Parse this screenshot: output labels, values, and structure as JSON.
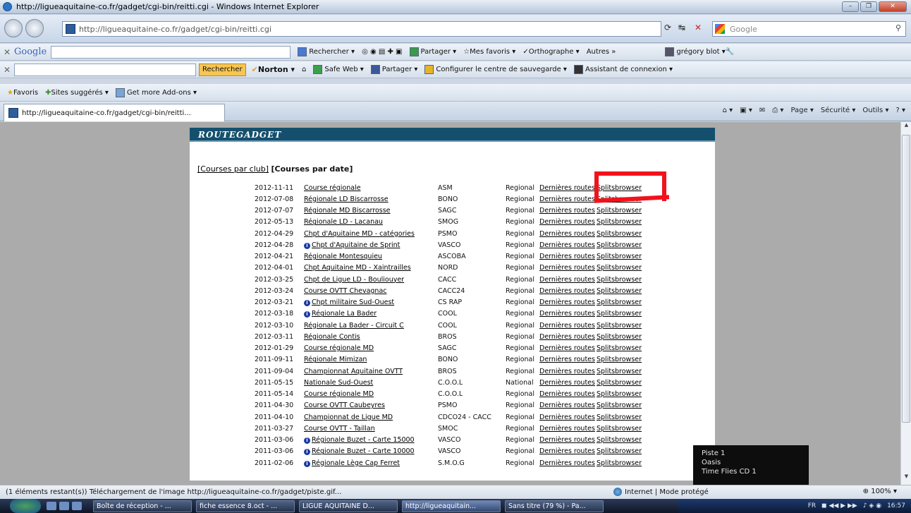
{
  "window": {
    "title": "http://ligueaquitaine-co.fr/gadget/cgi-bin/reitti.cgi - Windows Internet Explorer",
    "buttons": [
      "–",
      "❐",
      "✕"
    ]
  },
  "address": {
    "url": "http://ligueaquitaine-co.fr/gadget/cgi-bin/reitti.cgi",
    "search_placeholder": "Google"
  },
  "google_toolbar": {
    "logo": "Google",
    "items": [
      "Rechercher ▾",
      "Partager ▾",
      "Mes favoris ▾",
      "Orthographe ▾",
      "Autres »",
      "grégory blot ▾"
    ]
  },
  "norton_toolbar": {
    "search_button": "Rechercher",
    "norton": "Norton ▾",
    "items": [
      "Safe Web ▾",
      "Partager ▾",
      "Configurer le centre de sauvegarde ▾",
      "Assistant de connexion ▾"
    ]
  },
  "favorites_bar": {
    "favoris": "Favoris",
    "items": [
      "Sites suggérés ▾",
      "Get more Add-ons ▾"
    ]
  },
  "tab": {
    "label": "http://ligueaquitaine-co.fr/gadget/cgi-bin/reitti..."
  },
  "command_bar": [
    "Page ▾",
    "Sécurité ▾",
    "Outils ▾"
  ],
  "page": {
    "banner": "ROUTEGADGET",
    "nav_link": "[Courses par club]",
    "nav_current": "[Courses par date]",
    "rows": [
      {
        "date": "2012-11-11",
        "info": false,
        "name": "Course régionale",
        "club": "ASM",
        "type": "Regional",
        "l1": "Dernières routes",
        "l2": "Splitsbrowser"
      },
      {
        "date": "2012-07-08",
        "info": false,
        "name": "Régionale LD Biscarrosse",
        "club": "BONO",
        "type": "Regional",
        "l1": "Dernières routes",
        "l2": "Splitsbrowser"
      },
      {
        "date": "2012-07-07",
        "info": false,
        "name": "Régionale MD Biscarrosse",
        "club": "SAGC",
        "type": "Regional",
        "l1": "Dernières routes",
        "l2": "Splitsbrowser"
      },
      {
        "date": "2012-05-13",
        "info": false,
        "name": "Régionale LD - Lacanau",
        "club": "SMOG",
        "type": "Regional",
        "l1": "Dernières routes",
        "l2": "Splitsbrowser"
      },
      {
        "date": "2012-04-29",
        "info": false,
        "name": "Chpt d'Aquitaine MD - catégories",
        "club": "PSMO",
        "type": "Regional",
        "l1": "Dernières routes",
        "l2": "Splitsbrowser"
      },
      {
        "date": "2012-04-28",
        "info": true,
        "name": "Chpt d'Aquitaine de Sprint",
        "club": "VASCO",
        "type": "Regional",
        "l1": "Dernières routes",
        "l2": "Splitsbrowser"
      },
      {
        "date": "2012-04-21",
        "info": false,
        "name": "Régionale Montesquieu",
        "club": "ASCOBA",
        "type": "Regional",
        "l1": "Dernières routes",
        "l2": "Splitsbrowser"
      },
      {
        "date": "2012-04-01",
        "info": false,
        "name": "Chpt Aquitaine MD - Xaintrailles",
        "club": "NORD",
        "type": "Regional",
        "l1": "Dernières routes",
        "l2": "Splitsbrowser"
      },
      {
        "date": "2012-03-25",
        "info": false,
        "name": "Chpt de Ligue LD - Bouliouyer",
        "club": "CACC",
        "type": "Regional",
        "l1": "Dernières routes",
        "l2": "Splitsbrowser"
      },
      {
        "date": "2012-03-24",
        "info": false,
        "name": "Course OVTT Chevagnac",
        "club": "CACC24",
        "type": "Regional",
        "l1": "Dernières routes",
        "l2": "Splitsbrowser"
      },
      {
        "date": "2012-03-21",
        "info": true,
        "name": "Chpt militaire Sud-Ouest",
        "club": "CS RAP",
        "type": "Regional",
        "l1": "Dernières routes",
        "l2": "Splitsbrowser"
      },
      {
        "date": "2012-03-18",
        "info": true,
        "name": "Régionale La Bader",
        "club": "COOL",
        "type": "Regional",
        "l1": "Dernières routes",
        "l2": "Splitsbrowser"
      },
      {
        "date": "2012-03-10",
        "info": false,
        "name": "Régionale La Bader - Circuit C",
        "club": "COOL",
        "type": "Regional",
        "l1": "Dernières routes",
        "l2": "Splitsbrowser"
      },
      {
        "date": "2012-03-11",
        "info": false,
        "name": "Régionale Contis",
        "club": "BROS",
        "type": "Regional",
        "l1": "Dernières routes",
        "l2": "Splitsbrowser"
      },
      {
        "date": "2012-01-29",
        "info": false,
        "name": "Course régionale MD",
        "club": "SAGC",
        "type": "Regional",
        "l1": "Dernières routes",
        "l2": "Splitsbrowser"
      },
      {
        "date": "2011-09-11",
        "info": false,
        "name": "Régionale Mimizan",
        "club": "BONO",
        "type": "Regional",
        "l1": "Dernières routes",
        "l2": "Splitsbrowser"
      },
      {
        "date": "2011-09-04",
        "info": false,
        "name": "Championnat Aquitaine OVTT",
        "club": "BROS",
        "type": "Regional",
        "l1": "Dernières routes",
        "l2": "Splitsbrowser"
      },
      {
        "date": "2011-05-15",
        "info": false,
        "name": "Nationale Sud-Ouest",
        "club": "C.O.O.L",
        "type": "National",
        "l1": "Dernières routes",
        "l2": "Splitsbrowser"
      },
      {
        "date": "2011-05-14",
        "info": false,
        "name": "Course régionale MD",
        "club": "C.O.O.L",
        "type": "Regional",
        "l1": "Dernières routes",
        "l2": "Splitsbrowser"
      },
      {
        "date": "2011-04-30",
        "info": false,
        "name": "Course OVTT Caubeyres",
        "club": "PSMO",
        "type": "Regional",
        "l1": "Dernières routes",
        "l2": "Splitsbrowser"
      },
      {
        "date": "2011-04-10",
        "info": false,
        "name": "Championnat de Ligue MD",
        "club": "CDCO24 - CACC",
        "type": "Regional",
        "l1": "Dernières routes",
        "l2": "Splitsbrowser"
      },
      {
        "date": "2011-03-27",
        "info": false,
        "name": "Course OVTT - Taillan",
        "club": "SMOC",
        "type": "Regional",
        "l1": "Dernières routes",
        "l2": "Splitsbrowser"
      },
      {
        "date": "2011-03-06",
        "info": true,
        "name": "Régionale Buzet - Carte 15000",
        "club": "VASCO",
        "type": "Regional",
        "l1": "Dernières routes",
        "l2": "Splitsbrowser"
      },
      {
        "date": "2011-03-06",
        "info": true,
        "name": "Régionale Buzet - Carte 10000",
        "club": "VASCO",
        "type": "Regional",
        "l1": "Dernières routes",
        "l2": "Splitsbrowser"
      },
      {
        "date": "2011-02-06",
        "info": true,
        "name": "Régionale Lège Cap Ferret",
        "club": "S.M.O.G",
        "type": "Regional",
        "l1": "Dernières routes",
        "l2": "Splitsbrowser"
      }
    ]
  },
  "media_player": {
    "lines": [
      "Piste 1",
      "Oasis",
      "Time Flies CD 1"
    ],
    "progress_fraction": 0.1
  },
  "status": {
    "text": "(1 éléments restant(s)) Téléchargement de l'image http://ligueaquitaine-co.fr/gadget/piste.gif...",
    "zone": "Internet | Mode protégé",
    "zoom": "100%"
  },
  "taskbar": {
    "tasks": [
      "Boîte de réception - ...",
      "fiche essence 8.oct - ...",
      "LIGUE AQUITAINE D...",
      "http://ligueaquitain...",
      "Sans titre (79 %) - Pa..."
    ],
    "active_index": 3,
    "lang": "FR",
    "clock": "16:57"
  },
  "colors": {
    "banner": "#14506e",
    "highlight_mark": "#f2121c"
  }
}
